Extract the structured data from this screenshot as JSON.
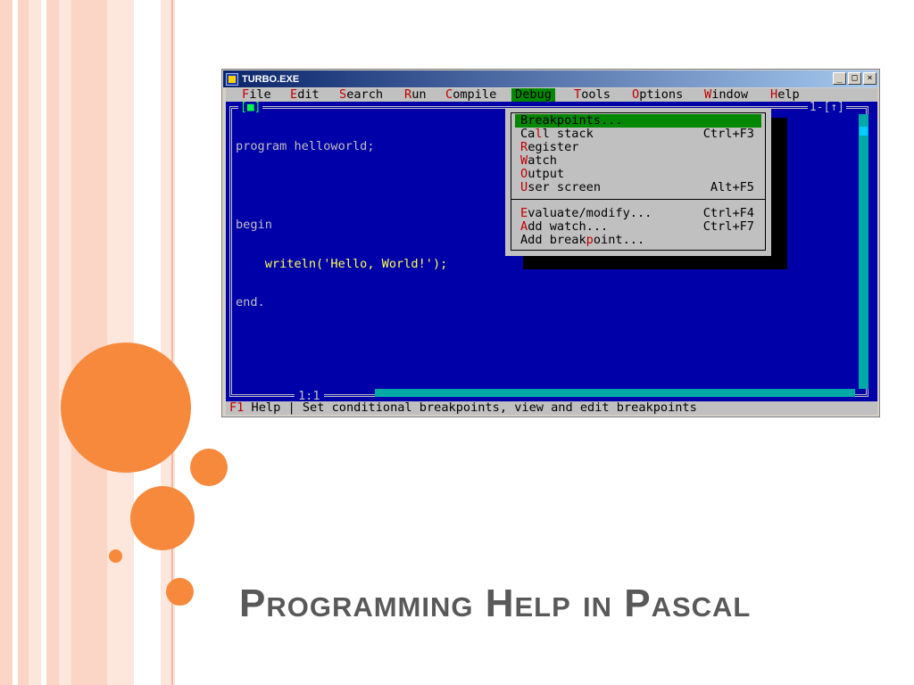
{
  "slide": {
    "title": "Programming Help in Pascal"
  },
  "window": {
    "title": "TURBO.EXE",
    "controls": {
      "minimize": "_",
      "maximize": "□",
      "close": "×"
    }
  },
  "menubar": {
    "items": [
      {
        "hk": "F",
        "rest": "ile"
      },
      {
        "hk": "E",
        "rest": "dit"
      },
      {
        "hk": "S",
        "rest": "earch"
      },
      {
        "hk": "R",
        "rest": "un"
      },
      {
        "hk": "C",
        "rest": "ompile"
      },
      {
        "hk": "D",
        "rest": "ebug"
      },
      {
        "hk": "T",
        "rest": "ools"
      },
      {
        "hk": "O",
        "rest": "ptions"
      },
      {
        "hk": "W",
        "rest": "indow"
      },
      {
        "hk": "H",
        "rest": "elp"
      }
    ],
    "active": "Debug"
  },
  "editor": {
    "frame_left": "[■]",
    "frame_right": "1-[↑]",
    "code_lines": [
      "program helloworld;",
      "",
      "begin",
      "    writeln('Hello, World!');",
      "end."
    ],
    "cursor_position": "1:1"
  },
  "debug_menu": {
    "items": [
      {
        "pre": "",
        "hk": "B",
        "post": "reakpoints...",
        "shortcut": ""
      },
      {
        "pre": "Ca",
        "hk": "l",
        "post": "l stack",
        "shortcut": "Ctrl+F3"
      },
      {
        "pre": "",
        "hk": "R",
        "post": "egister",
        "shortcut": ""
      },
      {
        "pre": "",
        "hk": "W",
        "post": "atch",
        "shortcut": ""
      },
      {
        "pre": "",
        "hk": "O",
        "post": "utput",
        "shortcut": ""
      },
      {
        "pre": "",
        "hk": "U",
        "post": "ser screen",
        "shortcut": "Alt+F5"
      },
      {
        "pre": "",
        "hk": "E",
        "post": "valuate/modify...",
        "shortcut": "Ctrl+F4"
      },
      {
        "pre": "",
        "hk": "A",
        "post": "dd watch...",
        "shortcut": "Ctrl+F7"
      },
      {
        "pre": "Add break",
        "hk": "p",
        "post": "oint...",
        "shortcut": ""
      }
    ],
    "selected_index": 0
  },
  "statusbar": {
    "key": "F1",
    "key_label": " Help",
    "sep": " | ",
    "message": "Set conditional breakpoints, view and edit breakpoints"
  },
  "colors": {
    "dos_blue": "#0000a8",
    "menu_gray": "#c0c0c0",
    "highlight_green": "#008800",
    "hotkey_red": "#c00000",
    "accent_orange": "#f7893c"
  }
}
